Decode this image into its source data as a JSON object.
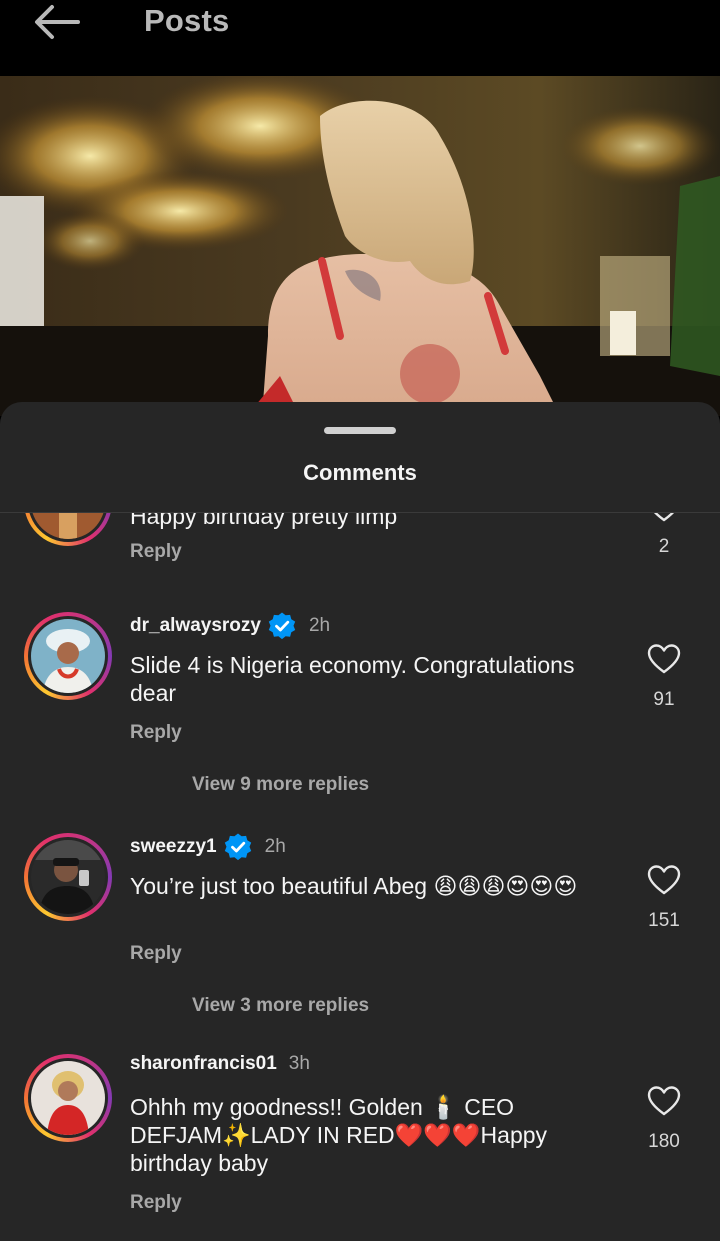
{
  "header": {
    "title": "Posts",
    "back_icon": "arrow-left-icon"
  },
  "sheet": {
    "title": "Comments"
  },
  "comments": [
    {
      "text": "Happy birthday pretty limp",
      "reply": "Reply",
      "likes": "2"
    },
    {
      "username": "dr_alwaysrozy",
      "verified": true,
      "time": "2h",
      "text": "Slide 4 is Nigeria economy. Congratulations dear",
      "reply": "Reply",
      "likes": "91",
      "view_more": "View 9 more replies"
    },
    {
      "username": "sweezzy1",
      "verified": true,
      "time": "2h",
      "text": "You’re just too beautiful Abeg 😩😩😩😍😍😍",
      "reply": "Reply",
      "likes": "151",
      "view_more": "View 3 more replies"
    },
    {
      "username": "sharonfrancis01",
      "verified": false,
      "time": "3h",
      "text": "Ohhh my goodness!! Golden 🕯️ CEO DEFJAM✨LADY IN RED❤️❤️❤️Happy birthday baby",
      "reply": "Reply",
      "likes": "180"
    }
  ],
  "colors": {
    "sheet_bg": "#262626",
    "verified": "#0095f6",
    "muted": "#a8a8a8"
  }
}
